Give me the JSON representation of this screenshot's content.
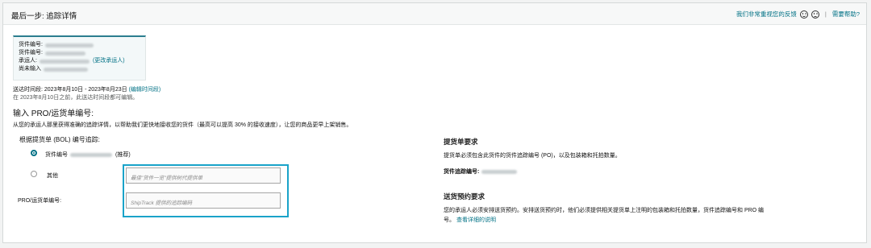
{
  "header": {
    "title": "最后一步: 追踪详情",
    "feedback_link": "我们非常重视您的反馈",
    "help_link": "需要帮助?"
  },
  "shipment": {
    "id_label": "货件编号:",
    "name_label": "货件编号:",
    "carrier_label": "承运人:",
    "carrier_change_link": "(更改承运人)",
    "not_entered_label": "尚未输入"
  },
  "delivery": {
    "window_text": "送达时间段: 2023年8月10日 - 2023年8月23日",
    "edit_link": "(编辑时间段)",
    "note": "在 2023年8月10日之前，此送达时间段都可编辑。"
  },
  "input_section": {
    "heading": "输入 PRO/运货单编号:",
    "description": "从您的承运人那里获得准确的追踪详情，以帮助我们更快地接收您的货件（最高可以提高 30% 的接收速度），让您的商品更早上架销售。",
    "bol_label": "根据提货单 (BOL) 编号追踪:",
    "option_shipment_label": "货件编号",
    "option_recommended": "(推荐)",
    "option_other_label": "其他",
    "other_placeholder": "最佳\"货件一览\"提供树代提供单",
    "pro_label": "PRO/运货单编号:",
    "pro_placeholder": "ShipTrack 提供的追踪编码"
  },
  "requirements": {
    "bol_title": "提货单要求",
    "bol_text": "提货单必须包含此货件的货件追踪编号 (PO)，以及包装箱和托拍数量。",
    "tracking_label": "货件追踪编号:",
    "appointment_title": "送货预约要求",
    "appointment_text_1": "您的承运人必须安排送货预约。安排送货预约时，他们必须提供相关提货单上注明的包装箱和托拍数量，货件追踪编号和 PRO 编",
    "appointment_text_2": "号。",
    "appointment_link": "查看详细的说明"
  }
}
